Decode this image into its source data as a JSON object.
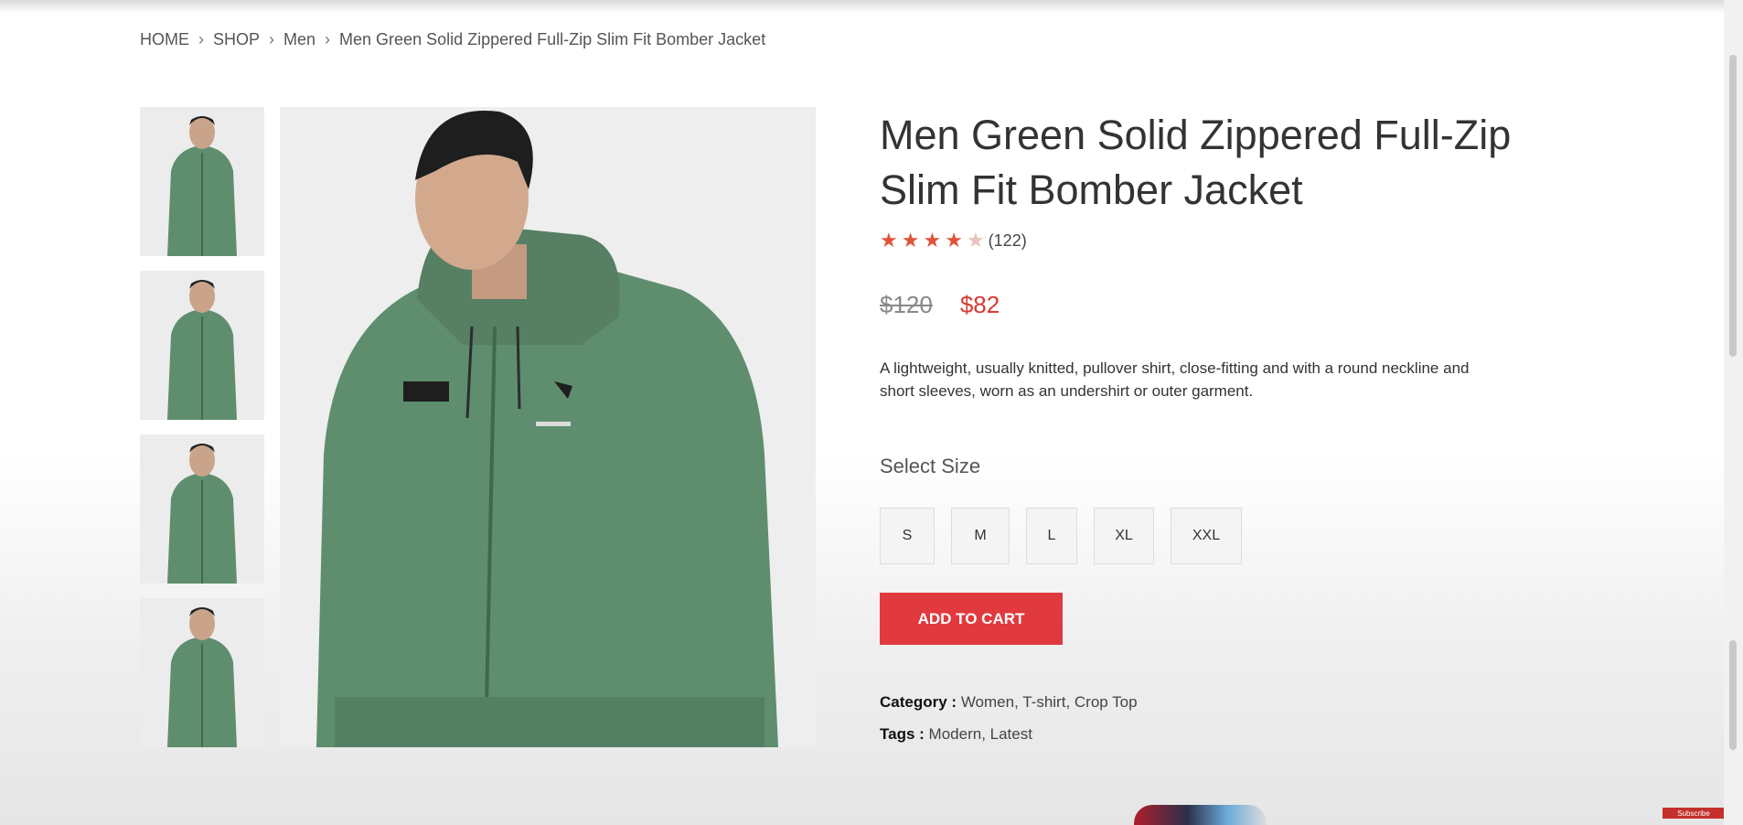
{
  "breadcrumb": {
    "items": [
      "HOME",
      "SHOP",
      "Men",
      "Men Green Solid Zippered Full-Zip Slim Fit Bomber Jacket"
    ]
  },
  "product": {
    "title": "Men Green Solid Zippered Full-Zip Slim Fit Bomber Jacket",
    "rating": 4,
    "rating_max": 5,
    "review_count": "(122)",
    "old_price": "$120",
    "new_price": "$82",
    "description": "A lightweight, usually knitted, pullover shirt, close-fitting and with a round neckline and short sleeves, worn as an undershirt or outer garment.",
    "select_size_label": "Select Size",
    "sizes": [
      "S",
      "M",
      "L",
      "XL",
      "XXL"
    ],
    "add_to_cart_label": "ADD TO CART",
    "category_label": "Category :",
    "category_value": "Women, T-shirt, Crop Top",
    "tags_label": "Tags :",
    "tags_value": "Modern, Latest"
  },
  "colors": {
    "accent": "#e0393e",
    "price_red": "#d73a34",
    "star": "#e0533a",
    "jacket_green": "#5e8e6e"
  },
  "overlay": {
    "subscribe_label": "Subscribe"
  }
}
